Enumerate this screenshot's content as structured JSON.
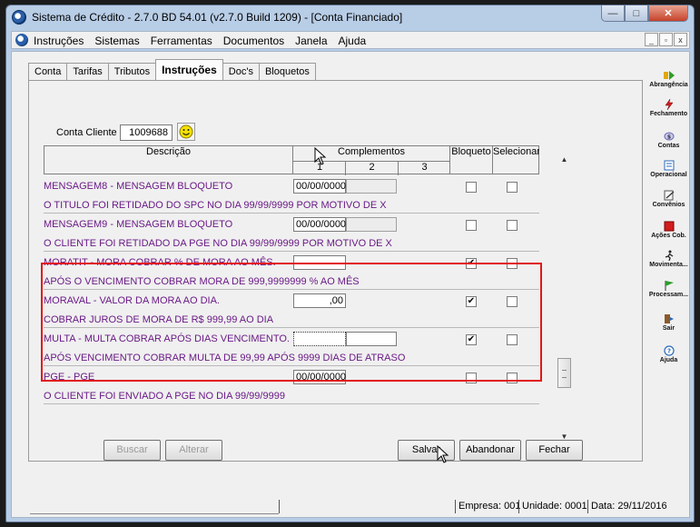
{
  "window": {
    "title": "Sistema de Crédito - 2.7.0 BD 54.01 (v2.7.0 Build 1209) - [Conta Financiado]",
    "min_label": "—",
    "max_label": "□",
    "close_label": "✕"
  },
  "menu": {
    "items": [
      {
        "label": "Instruções"
      },
      {
        "label": "Sistemas"
      },
      {
        "label": "Ferramentas"
      },
      {
        "label": "Documentos"
      },
      {
        "label": "Janela"
      },
      {
        "label": "Ajuda"
      }
    ],
    "mdi_min": "_",
    "mdi_restore": "▫",
    "mdi_close": "x"
  },
  "tabs": [
    "Conta",
    "Tarifas",
    "Tributos",
    "Instruções",
    "Doc's",
    "Bloquetos"
  ],
  "client": {
    "label": "Conta Cliente",
    "value": "1009688"
  },
  "grid": {
    "headers": {
      "descricao": "Descrição",
      "complementos": "Complementos",
      "bloqueto": "Bloqueto",
      "selecionar": "Selecionar",
      "c1": "1",
      "c2": "2",
      "c3": "3"
    },
    "rows": [
      {
        "title": "MENSAGEM8 - MENSAGEM BLOQUETO",
        "detail": "O TITULO FOI RETIDADO DO SPC NO DIA 99/99/9999 POR MOTIVO DE X",
        "c1": "00/00/0000",
        "bloqueto": false,
        "selecionar": false
      },
      {
        "title": "MENSAGEM9 - MENSAGEM BLOQUETO",
        "detail": "O CLIENTE FOI RETIDADO DA PGE NO DIA 99/99/9999 POR MOTIVO DE X",
        "c1": "00/00/0000",
        "bloqueto": false,
        "selecionar": false
      },
      {
        "title": "MORATIT - MORA COBRAR % DE MORA AO MÊS.",
        "detail": "APÓS O VENCIMENTO COBRAR MORA DE 999,9999999 % AO MÊS",
        "c1": "",
        "bloqueto": true,
        "selecionar": false
      },
      {
        "title": "MORAVAL - VALOR DA MORA AO DIA.",
        "detail": "COBRAR JUROS DE MORA DE R$ 999,99 AO DIA",
        "c1": ",00",
        "bloqueto": true,
        "selecionar": false
      },
      {
        "title": "MULTA - MULTA COBRAR APÓS DIAS VENCIMENTO.",
        "detail": "APÓS VENCIMENTO COBRAR MULTA DE 99,99 APÓS 9999 DIAS DE ATRASO",
        "c1": "",
        "bloqueto": true,
        "selecionar": false
      },
      {
        "title": "PGE - PGE",
        "detail": "O CLIENTE FOI ENVIADO A PGE NO DIA 99/99/9999",
        "c1": "00/00/0000",
        "bloqueto": false,
        "selecionar": false
      }
    ],
    "check_mark": "✔"
  },
  "buttons": {
    "buscar": "Buscar",
    "alterar": "Alterar",
    "salvar": "Salvar",
    "abandonar": "Abandonar",
    "fechar": "Fechar"
  },
  "status": {
    "empresa": "Empresa: 001",
    "unidade": "Unidade: 0001",
    "data": "Data:  29/11/2016"
  },
  "toolbar": [
    {
      "label": "Abrangência",
      "icon": "scope-icon",
      "color": "#2e9c2e"
    },
    {
      "label": "Fechamento",
      "icon": "lightning-icon",
      "color": "#d11d1d"
    },
    {
      "label": "Contas",
      "icon": "accounts-icon",
      "color": "#6a6ab0"
    },
    {
      "label": "Operacional",
      "icon": "operational-icon",
      "color": "#2a6ab8"
    },
    {
      "label": "Convênios",
      "icon": "agreements-icon",
      "color": "#555555"
    },
    {
      "label": "Ações Cob.",
      "icon": "collection-actions-icon",
      "color": "#d11d1d"
    },
    {
      "label": "Movimenta...",
      "icon": "movement-icon",
      "color": "#222222"
    },
    {
      "label": "Processam...",
      "icon": "processing-icon",
      "color": "#2e9c2e"
    },
    {
      "label": "Sair",
      "icon": "exit-icon",
      "color": "#2a6ab8"
    },
    {
      "label": "Ajuda",
      "icon": "help-icon",
      "color": "#2a6ab8"
    }
  ],
  "colors": {
    "row_text": "#6a1a86",
    "highlight": "#e11818",
    "window_frame": "#b8cde6"
  }
}
